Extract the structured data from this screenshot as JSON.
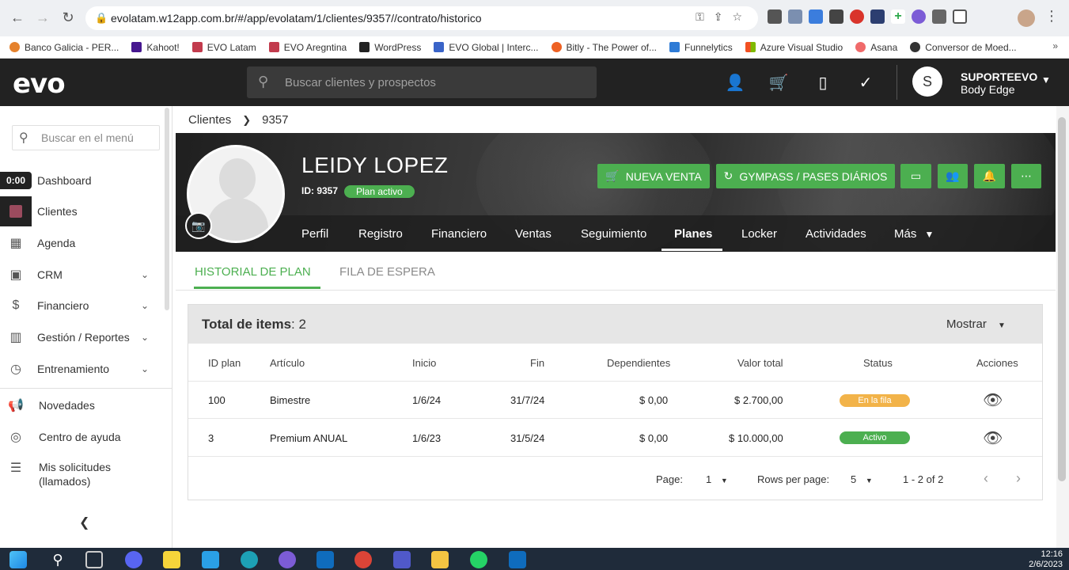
{
  "browser": {
    "url": "evolatam.w12app.com.br/#/app/evolatam/1/clientes/9357//contrato/historico",
    "bookmarks": [
      "Banco Galicia - PER...",
      "Kahoot!",
      "EVO Latam",
      "EVO Aregntina",
      "WordPress",
      "EVO Global | Interc...",
      "Bitly - The Power of...",
      "Funnelytics",
      "Azure Visual Studio",
      "Asana",
      "Conversor de Moed..."
    ]
  },
  "header": {
    "logo": "evo",
    "search_placeholder": "Buscar clientes y prospectos",
    "user_initial": "S",
    "user_name": "SUPORTEEVO",
    "user_company": "Body Edge"
  },
  "sidebar": {
    "search_placeholder": "Buscar en el menú",
    "time_badge": "0:00",
    "items": [
      {
        "label": "Dashboard"
      },
      {
        "label": "Clientes"
      },
      {
        "label": "Agenda"
      },
      {
        "label": "CRM"
      },
      {
        "label": "Financiero"
      },
      {
        "label": "Gestión / Reportes"
      },
      {
        "label": "Entrenamiento"
      },
      {
        "label": "Novedades"
      },
      {
        "label": "Centro de ayuda"
      },
      {
        "label": "Mis solicitudes"
      },
      {
        "label": "(llamados)"
      }
    ]
  },
  "breadcrumb": {
    "root": "Clientes",
    "current": "9357"
  },
  "client": {
    "name": "LEIDY LOPEZ",
    "id_label": "ID: 9357",
    "plan_badge": "Plan activo"
  },
  "hero_buttons": {
    "nueva_venta": "NUEVA VENTA",
    "gympass": "GYMPASS / PASES DIÁRIOS"
  },
  "client_tabs": [
    "Perfil",
    "Registro",
    "Financiero",
    "Ventas",
    "Seguimiento",
    "Planes",
    "Locker",
    "Actividades",
    "Más"
  ],
  "sub_tabs": [
    "HISTORIAL DE PLAN",
    "FILA DE ESPERA"
  ],
  "table": {
    "total_label": "Total de items",
    "total_value": ": 2",
    "mostrar": "Mostrar",
    "headers": [
      "ID plan",
      "Artículo",
      "Inicio",
      "Fin",
      "Dependientes",
      "Valor total",
      "Status",
      "Acciones"
    ],
    "rows": [
      {
        "id": "100",
        "articulo": "Bimestre",
        "inicio": "1/6/24",
        "fin": "31/7/24",
        "dependientes": "$ 0,00",
        "valor": "$ 2.700,00",
        "status": "En la fila",
        "status_color": "#f2b349"
      },
      {
        "id": "3",
        "articulo": "Premium ANUAL",
        "inicio": "1/6/23",
        "fin": "31/5/24",
        "dependientes": "$ 0,00",
        "valor": "$ 10.000,00",
        "status": "Activo",
        "status_color": "#4caf50"
      }
    ],
    "pager": {
      "page_label": "Page:",
      "page_value": "1",
      "rows_label": "Rows per page:",
      "rows_value": "5",
      "range": "1 - 2 of 2"
    }
  },
  "taskbar": {
    "time": "12:16",
    "date": "2/6/2023"
  },
  "colors": {
    "accent": "#4caf50",
    "header": "#222222",
    "warning": "#f2b349"
  }
}
